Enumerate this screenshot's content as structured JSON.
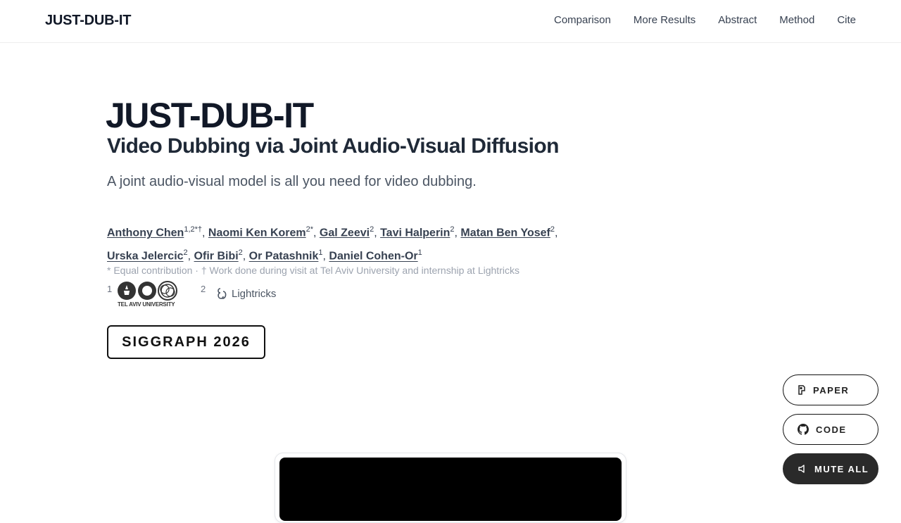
{
  "nav": {
    "brand": "JUST-DUB-IT",
    "links": [
      "Comparison",
      "More Results",
      "Abstract",
      "Method",
      "Cite"
    ]
  },
  "hero": {
    "title": "JUST-DUB-IT",
    "subtitle": "Video Dubbing via Joint Audio-Visual Diffusion",
    "tagline": "A joint audio-visual model is all you need for video dubbing."
  },
  "authors": [
    {
      "name": "Anthony Chen",
      "sup": "1,2*†"
    },
    {
      "name": "Naomi Ken Korem",
      "sup": "2*"
    },
    {
      "name": "Gal Zeevi",
      "sup": "2"
    },
    {
      "name": "Tavi Halperin",
      "sup": "2"
    },
    {
      "name": "Matan Ben Yosef",
      "sup": "2"
    },
    {
      "name": "Urska Jelercic",
      "sup": "2"
    },
    {
      "name": "Ofir Bibi",
      "sup": "2"
    },
    {
      "name": "Or Patashnik",
      "sup": "1"
    },
    {
      "name": "Daniel Cohen-Or",
      "sup": "1"
    }
  ],
  "footnote": "* Equal contribution · † Work done during visit at Tel Aviv University and internship at Lightricks",
  "affiliations": {
    "tau_num": "1",
    "tau_label": "TEL AVIV UNIVERSITY",
    "lightricks_num": "2",
    "lightricks_label": "Lightricks"
  },
  "badge": "SIGGRAPH 2026",
  "buttons": {
    "paper": "PAPER",
    "code": "CODE",
    "mute": "MUTE ALL"
  },
  "icons": {
    "paper": "paper-icon",
    "code": "github-icon",
    "mute": "speaker-icon"
  }
}
